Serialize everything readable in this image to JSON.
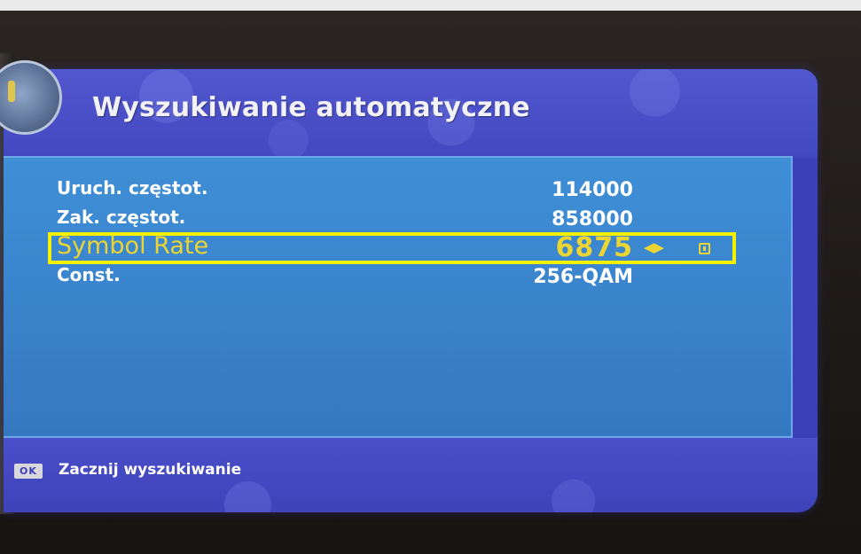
{
  "window": {
    "title": "Wyszukiwanie automatyczne"
  },
  "settings": {
    "rows": [
      {
        "label": "Uruch. częstot.",
        "value": "114000"
      },
      {
        "label": "Zak. częstot.",
        "value": "858000"
      },
      {
        "label": "Symbol Rate",
        "value": "6875",
        "selected": true,
        "arrows": "◀▶"
      },
      {
        "label": "Const.",
        "value": "256-QAM"
      }
    ]
  },
  "footer": {
    "ok_key": "OK",
    "action_label": "Zacznij wyszukiwanie"
  },
  "icons": {
    "clock": "clock-icon",
    "arrows": "left-right-arrows-icon",
    "edit": "edit-icon",
    "ok": "ok-key-icon"
  },
  "colors": {
    "panel_header": "#4248c0",
    "list_background": "#3a84cc",
    "selected_text": "#ecd433",
    "highlight_border": "#f3f000",
    "text": "#ffffff"
  }
}
